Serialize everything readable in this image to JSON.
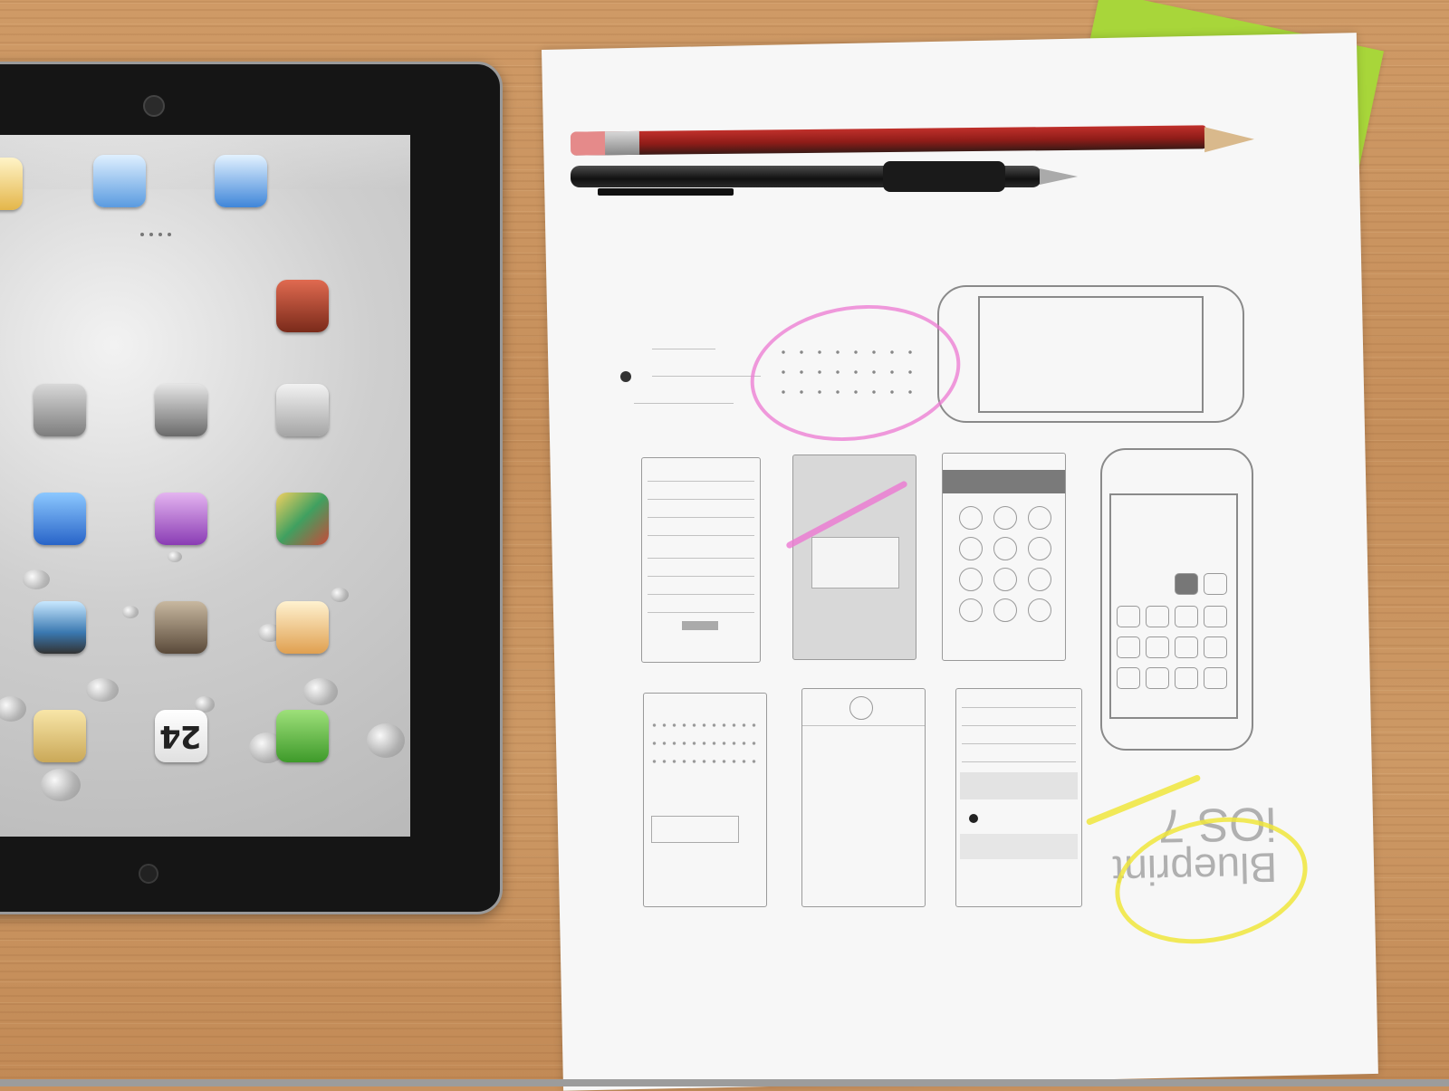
{
  "scene": {
    "colors": {
      "desk": "#c9915e",
      "paper": "#f7f7f7",
      "sticky_note": "#a8d63a",
      "tablet_bezel": "#151515",
      "pencil": "#c0302b",
      "pink_marker": "#ec78d2",
      "yellow_marker": "#f0e63c"
    }
  },
  "tablet": {
    "calendar_icon_number": "24",
    "icons": [
      "photos-icon",
      "mail-icon",
      "safari-icon",
      "video-icon",
      "settings-icon",
      "clock-icon",
      "camera-icon",
      "app-store-icon",
      "itunes-icon",
      "game-center-icon",
      "maps-icon",
      "newsstand-icon",
      "contacts-icon",
      "notes-icon",
      "calendar-icon",
      "messages-icon"
    ]
  },
  "paper": {
    "blueprint_title": "iOS 7",
    "blueprint_subtitle": "Blueprint"
  }
}
